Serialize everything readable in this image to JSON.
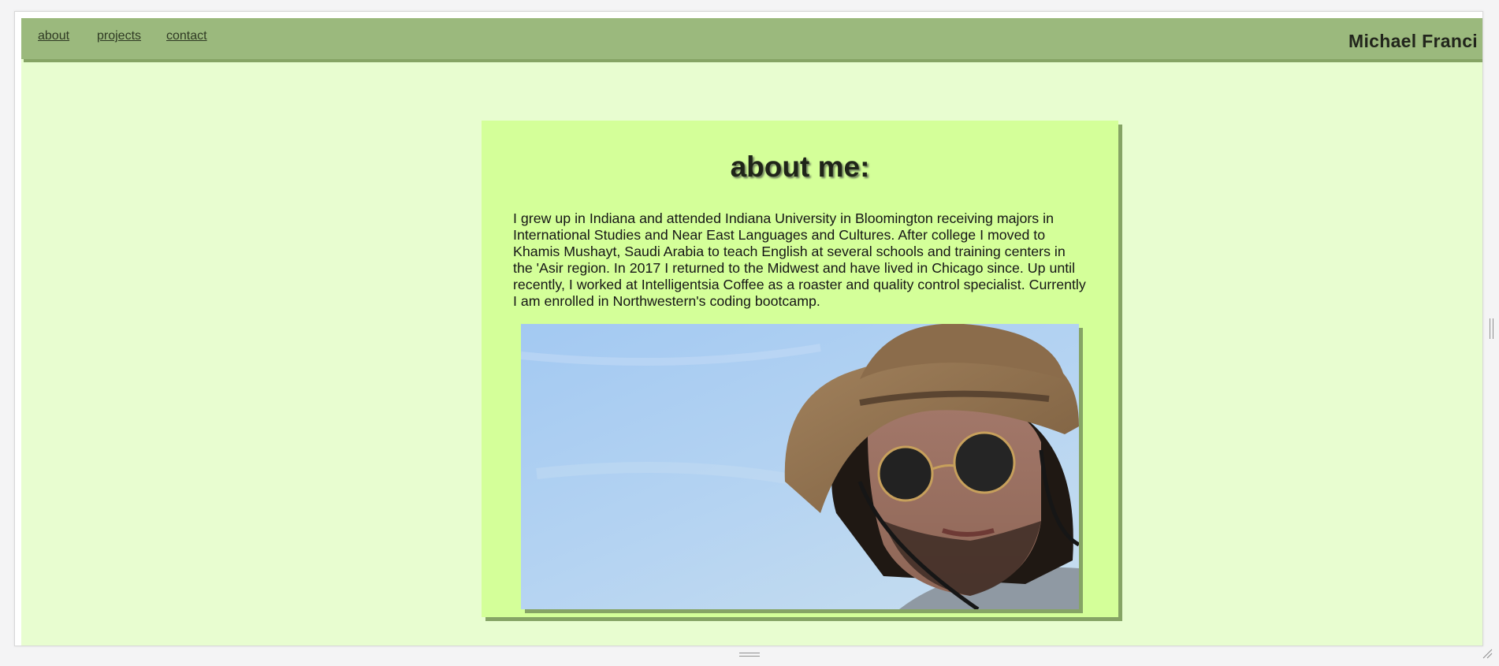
{
  "nav": {
    "links": [
      {
        "label": "about"
      },
      {
        "label": "projects"
      },
      {
        "label": "contact"
      }
    ],
    "brand": "Michael Franci"
  },
  "about": {
    "title": "about me:",
    "bio": "I grew up in Indiana and attended Indiana University in Bloomington receiving majors in International Studies and Near East Languages and Cultures. After college I moved to Khamis Mushayt, Saudi Arabia to teach English at several schools and training centers in the 'Asir region. In 2017 I returned to the Midwest and have lived in Chicago since. Up until recently, I worked at Intelligentsia Coffee as a roaster and quality control specialist. Currently I am enrolled in Northwestern's coding bootcamp."
  },
  "colors": {
    "navbar": "#9bb97d",
    "page_bg": "#e8fdd0",
    "card_bg": "#d4ff99",
    "shadow": "#86a465"
  }
}
